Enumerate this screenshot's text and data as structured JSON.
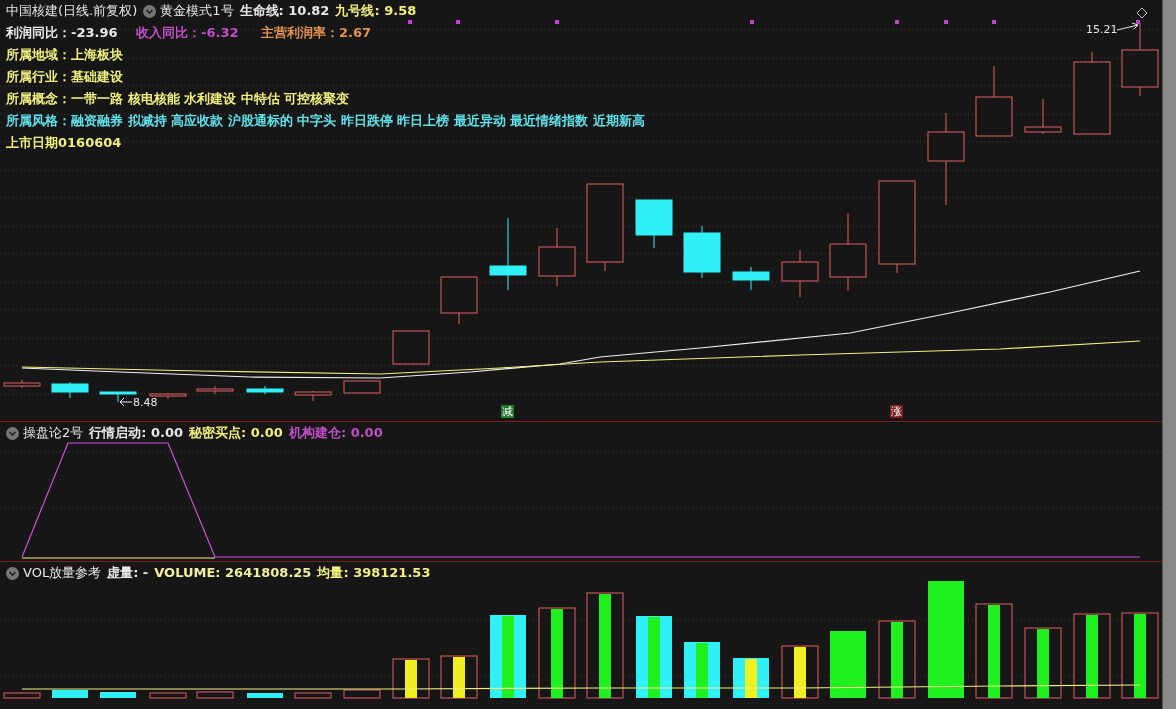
{
  "main_panel": {
    "title": "中国核建(日线.前复权)",
    "indicator": "黄金模式1号",
    "readings": [
      {
        "text": "生命线: 10.82",
        "color": "#e8e8e8"
      },
      {
        "text": "九号线: 9.58",
        "color": "#f0f080"
      }
    ],
    "stats": [
      {
        "text": "利润同比：-23.96",
        "color": "#e8e8e8"
      },
      {
        "text": "收入同比：-6.32",
        "color": "#c050c8"
      },
      {
        "text": "主营利润率：2.67",
        "color": "#e09050"
      }
    ],
    "info_lines": [
      {
        "text": "所属地域：上海板块",
        "color": "#f0f080"
      },
      {
        "text": "所属行业：基础建设",
        "color": "#f0f080"
      },
      {
        "text": "所属概念：一带一路 核电核能 水利建设 中特估 可控核聚变",
        "color": "#f0f080"
      },
      {
        "text": "所属风格：融资融券 拟减持 高应收款 沪股通标的 中字头 昨日跌停 昨日上榜 最近异动 最近情绪指数 近期新高",
        "color": "#60e0e8"
      },
      {
        "text": "上市日期0160604",
        "color": "#f0f080"
      }
    ],
    "high_label": "15.21",
    "low_label": "8.48",
    "signals": [
      {
        "text": "减",
        "color": "#1f7a2a"
      },
      {
        "text": "涨",
        "color": "#7a1f1f"
      }
    ]
  },
  "indicator_panel": {
    "title": "操盘论2号",
    "readings": [
      {
        "text": "行情启动: 0.00",
        "color": "#e8e8e8"
      },
      {
        "text": "秘密买点: 0.00",
        "color": "#f0f080"
      },
      {
        "text": "机构建仓: 0.00",
        "color": "#c050c8"
      }
    ]
  },
  "volume_panel": {
    "title": "VOL放量参考",
    "readings": [
      {
        "text": "虚量: -",
        "color": "#e8e8e8"
      },
      {
        "text": "VOLUME: 2641808.25",
        "color": "#f0f0a0"
      },
      {
        "text": "均量: 398121.53",
        "color": "#f0f080"
      }
    ]
  }
}
